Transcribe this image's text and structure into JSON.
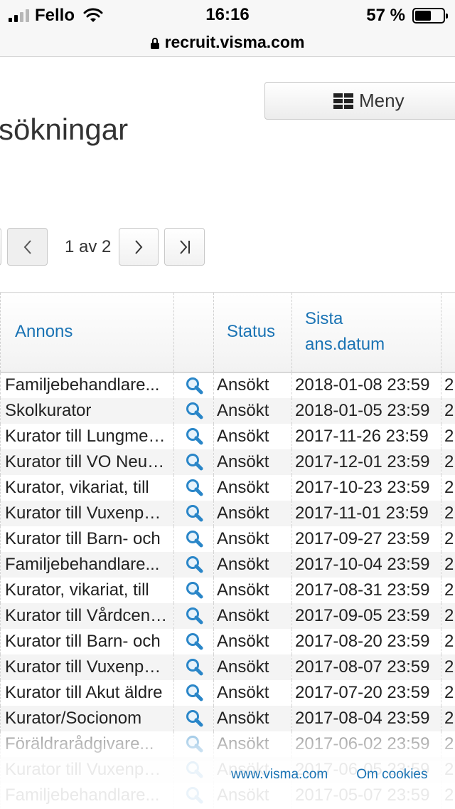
{
  "status_bar": {
    "carrier": "Fello",
    "time": "16:16",
    "battery": "57 %",
    "battery_level": 0.57
  },
  "browser": {
    "url": "recruit.visma.com"
  },
  "page": {
    "title": "sökningar",
    "menu_label": "Meny"
  },
  "pagination": {
    "info": "1 av 2"
  },
  "table": {
    "headers": {
      "annons": "Annons",
      "status": "Status",
      "date_line1": "Sista",
      "date_line2": "ans.datum"
    },
    "rows": [
      {
        "annons": "Familjebehandlare...",
        "status": "Ansökt",
        "date": "2018-01-08 23:59",
        "extra": "2"
      },
      {
        "annons": "Skolkurator",
        "status": "Ansökt",
        "date": "2018-01-05 23:59",
        "extra": "2"
      },
      {
        "annons": "Kurator till Lungmedicin",
        "status": "Ansökt",
        "date": "2017-11-26 23:59",
        "extra": "2"
      },
      {
        "annons": "Kurator till VO Neurologi",
        "status": "Ansökt",
        "date": "2017-12-01 23:59",
        "extra": "2"
      },
      {
        "annons": "Kurator, vikariat, till",
        "status": "Ansökt",
        "date": "2017-10-23 23:59",
        "extra": "2"
      },
      {
        "annons": "Kurator till Vuxenpsykiatri",
        "status": "Ansökt",
        "date": "2017-11-01 23:59",
        "extra": "2"
      },
      {
        "annons": "Kurator till Barn- och",
        "status": "Ansökt",
        "date": "2017-09-27 23:59",
        "extra": "2"
      },
      {
        "annons": "Familjebehandlare...",
        "status": "Ansökt",
        "date": "2017-10-04 23:59",
        "extra": "2"
      },
      {
        "annons": "Kurator, vikariat, till",
        "status": "Ansökt",
        "date": "2017-08-31 23:59",
        "extra": "2"
      },
      {
        "annons": "Kurator till Vårdcentral",
        "status": "Ansökt",
        "date": "2017-09-05 23:59",
        "extra": "2"
      },
      {
        "annons": "Kurator till Barn- och",
        "status": "Ansökt",
        "date": "2017-08-20 23:59",
        "extra": "2"
      },
      {
        "annons": "Kurator till Vuxenpsykiatri",
        "status": "Ansökt",
        "date": "2017-08-07 23:59",
        "extra": "2"
      },
      {
        "annons": "Kurator till Akut äldre",
        "status": "Ansökt",
        "date": "2017-07-20 23:59",
        "extra": "2"
      },
      {
        "annons": "Kurator/Socionom",
        "status": "Ansökt",
        "date": "2017-08-04 23:59",
        "extra": "2"
      },
      {
        "annons": "Föräldrarådgivare...",
        "status": "Ansökt",
        "date": "2017-06-02 23:59",
        "extra": "2"
      },
      {
        "annons": "Kurator till Vuxenpsykiatri",
        "status": "Ansökt",
        "date": "2017-06-05 23:59",
        "extra": "2"
      },
      {
        "annons": "Familjebehandlare...",
        "status": "Ansökt",
        "date": "2017-05-07 23:59",
        "extra": "2"
      }
    ]
  },
  "footer": {
    "link1": "www.visma.com",
    "link2": "Om cookies"
  },
  "colors": {
    "link": "#1a73b4",
    "icon": "#2a86c8"
  }
}
